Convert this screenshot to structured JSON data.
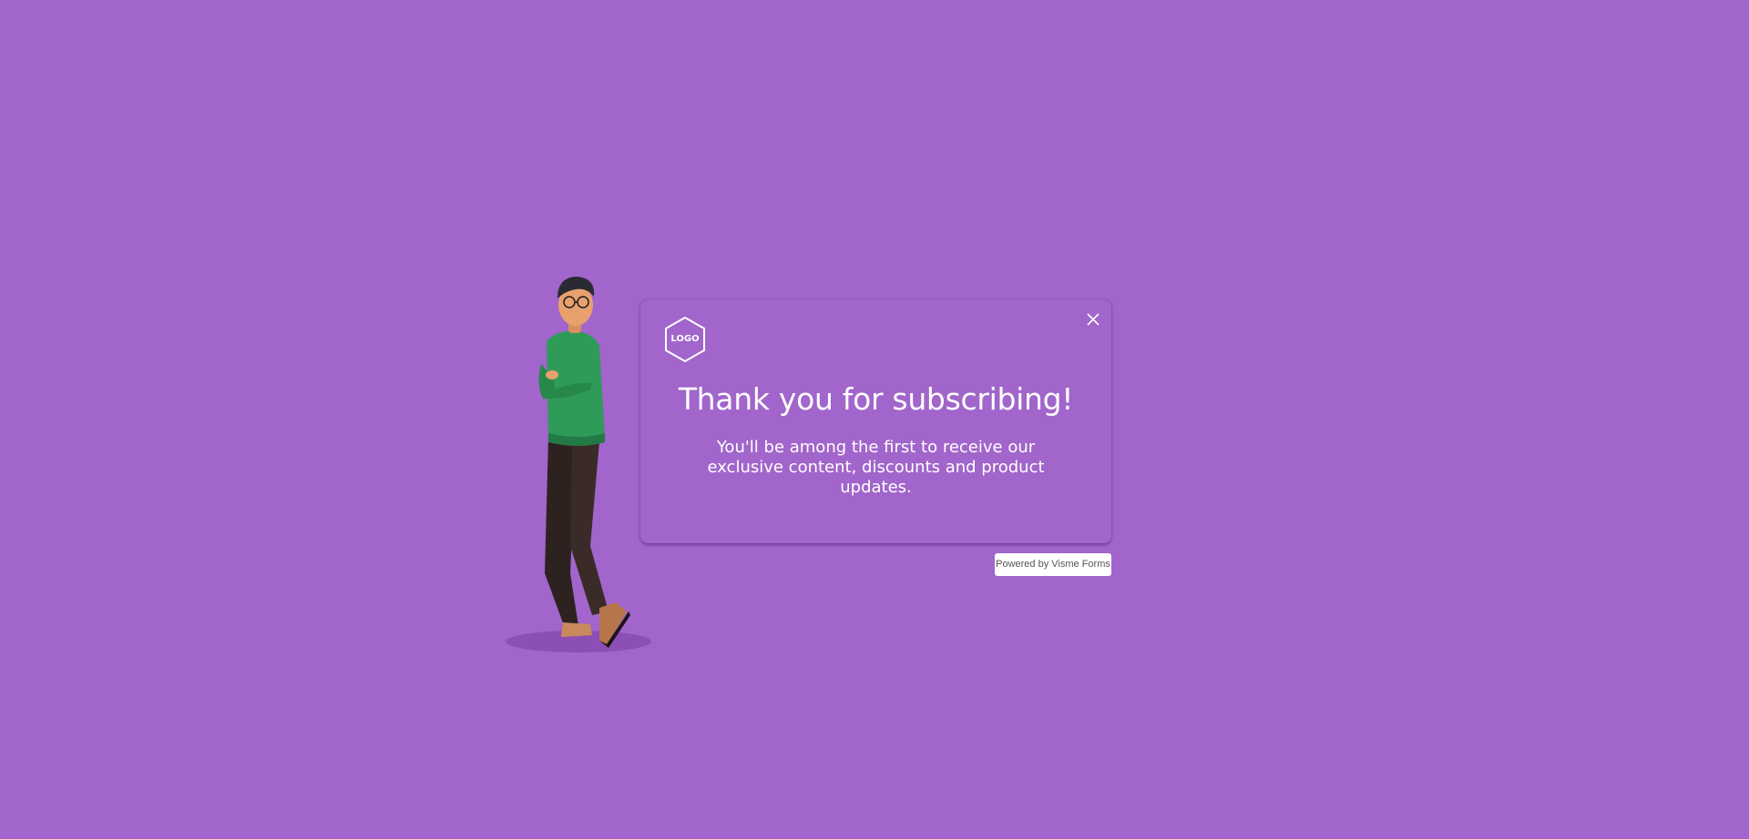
{
  "page": {
    "background_color": "#a165cb"
  },
  "card": {
    "logo_text": "LOGO",
    "logo_icon": "hexagon-logo-icon",
    "close_icon": "close-icon",
    "title": "Thank you for subscribing!",
    "message": "You'll be among the first to receive our exclusive content, discounts and product updates."
  },
  "footer": {
    "powered_label": "Powered by Visme Forms"
  },
  "illustration": {
    "icon": "3d-character-illustration",
    "sweater_color": "#2f9b58",
    "pants_color": "#3a2b28",
    "skin_color": "#e8a06d"
  }
}
